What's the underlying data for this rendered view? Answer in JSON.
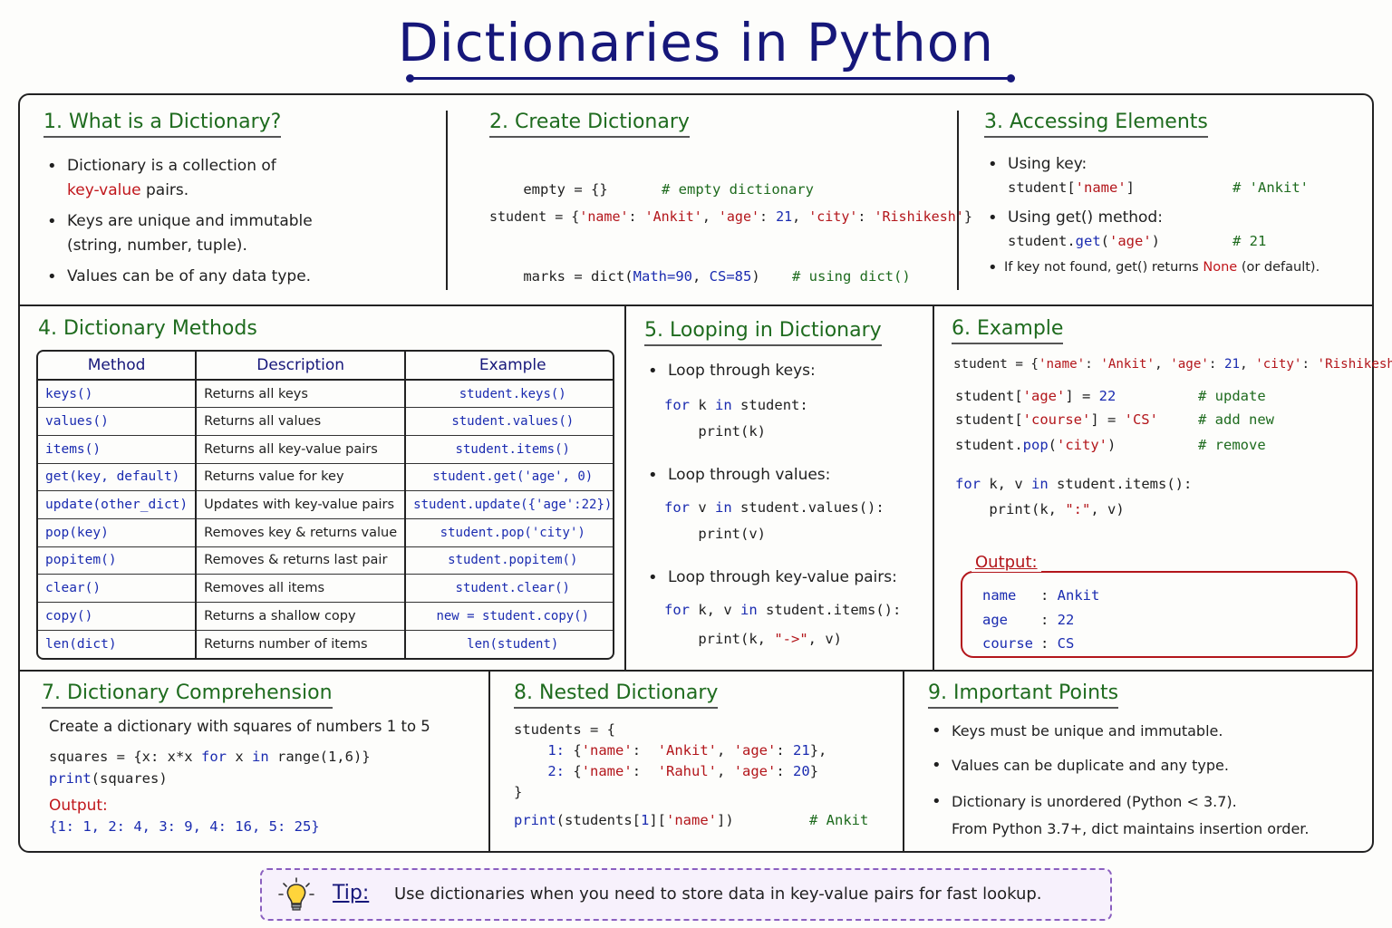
{
  "title": "Dictionaries in Python",
  "s1": {
    "heading": "1. What is a Dictionary?",
    "b1a": "Dictionary is a collection of",
    "b1b": "key-value",
    "b1c": "pairs.",
    "b2a": "Keys are unique and immutable",
    "b2b": "(string, number, tuple).",
    "b3": "Values can be of any data type."
  },
  "s2": {
    "heading": "2. Create Dictionary",
    "l1_code": "empty = {}",
    "l1_comment": "# empty dictionary",
    "l2_a": "student = {",
    "l2_k1": "'name'",
    "l2_v1": "'Ankit'",
    "l2_k2": "'age'",
    "l2_v2": "21",
    "l2_k3": "'city'",
    "l2_v3": "'Rishikesh'",
    "l3_a": "marks = dict(",
    "l3_arg1": "Math=90",
    "l3_arg2": "CS=85",
    "l3_comment": "# using dict()"
  },
  "s3": {
    "heading": "3. Accessing Elements",
    "b1": "Using key:",
    "c1_a": "student[",
    "c1_s": "'name'",
    "c1_comment": "# 'Ankit'",
    "b2": "Using get() method:",
    "c2_a": "student.",
    "c2_f": "get",
    "c2_s": "'age'",
    "c2_comment": "# 21",
    "b3a": "If key not found, get() returns",
    "b3b": "None",
    "b3c": "(or default)."
  },
  "s4": {
    "heading": "4. Dictionary Methods",
    "columns": [
      "Method",
      "Description",
      "Example"
    ],
    "rows": [
      [
        "keys()",
        "Returns all keys",
        "student.keys()"
      ],
      [
        "values()",
        "Returns all values",
        "student.values()"
      ],
      [
        "items()",
        "Returns all key-value pairs",
        "student.items()"
      ],
      [
        "get(key, default)",
        "Returns value for key",
        "student.get('age', 0)"
      ],
      [
        "update(other_dict)",
        "Updates with key-value pairs",
        "student.update({'age':22})"
      ],
      [
        "pop(key)",
        "Removes key & returns value",
        "student.pop('city')"
      ],
      [
        "popitem()",
        "Removes & returns last pair",
        "student.popitem()"
      ],
      [
        "clear()",
        "Removes all items",
        "student.clear()"
      ],
      [
        "copy()",
        "Returns a shallow copy",
        "new = student.copy()"
      ],
      [
        "len(dict)",
        "Returns number of items",
        "len(student)"
      ]
    ]
  },
  "s5": {
    "heading": "5. Looping in Dictionary",
    "b1": "Loop through keys:",
    "c1a_kw": "for",
    "c1a_v": "k",
    "c1a_in": "in",
    "c1a_r": "student:",
    "c1b": "print(k)",
    "b2": "Loop through values:",
    "c2a_v": "v",
    "c2a_r": "student.values():",
    "c2b": "print(v)",
    "b3": "Loop through key-value pairs:",
    "c3a_v": "k, v",
    "c3a_r": "student.items():",
    "c3b_a": "print(k, ",
    "c3b_s": "\"->\"",
    "c3b_c": ", v)"
  },
  "s6": {
    "heading": "6. Example",
    "line1_a": "student = {",
    "line1_k1": "'name'",
    "line1_v1": "'Ankit'",
    "line1_k2": "'age'",
    "line1_v2": "21",
    "line1_k3": "'city'",
    "line1_v3": "'Rishikesh'",
    "u1_a": "student[",
    "u1_s": "'age'",
    "u1_b": "] = ",
    "u1_n": "22",
    "u1_c": "# update",
    "u2_a": "student[",
    "u2_s": "'course'",
    "u2_b": "] = ",
    "u2_v": "'CS'",
    "u2_c": "# add new",
    "u3_a": "student.",
    "u3_f": "pop",
    "u3_s": "'city'",
    "u3_c": "# remove",
    "f1_kw": "for",
    "f1_v": "k, v",
    "f1_in": "in",
    "f1_r": "student.items():",
    "f2_a": "print(k, ",
    "f2_s": "\":\"",
    "f2_c": ", v)",
    "output_label": "Output:",
    "output": [
      [
        "name",
        "Ankit"
      ],
      [
        "age",
        "22"
      ],
      [
        "course",
        "CS"
      ]
    ]
  },
  "s7": {
    "heading": "7. Dictionary Comprehension",
    "desc": "Create a dictionary with squares of numbers 1 to 5",
    "c1_a": "squares = {x: x*x ",
    "c1_for": "for",
    "c1_b": " x ",
    "c1_in": "in",
    "c1_c": " range(1,6)}",
    "c2": "print(squares)",
    "output_label": "Output:",
    "output": "{1: 1, 2: 4, 3: 9, 4: 16, 5: 25}"
  },
  "s8": {
    "heading": "8. Nested Dictionary",
    "l1": "students = {",
    "l2_k": "1:",
    "l2_a": "{",
    "l2_s1": "'name'",
    "l2_v1": "'Ankit'",
    "l2_s2": "'age'",
    "l2_v2": "21",
    "l3_k": "2:",
    "l3_s1": "'name'",
    "l3_v1": "'Rahul'",
    "l3_s2": "'age'",
    "l3_v2": "20",
    "l4": "}",
    "p_a": "print",
    "p_b": "(students[",
    "p_n": "1",
    "p_c": "][",
    "p_s": "'name'",
    "p_d": "])",
    "p_comment": "# Ankit"
  },
  "s9": {
    "heading": "9. Important Points",
    "b1": "Keys must be unique and immutable.",
    "b2": "Values can be duplicate and any type.",
    "b3a": "Dictionary is unordered (Python < 3.7).",
    "b3b": "From Python 3.7+, dict maintains insertion order."
  },
  "tip": {
    "label": "Tip:",
    "text": "Use dictionaries when you need to store data in key-value pairs for fast lookup."
  },
  "colors": {
    "title": "#16177a",
    "heading": "#1e6b1e",
    "keyword": "#1a2bb0",
    "string": "#b3161b",
    "tip_border": "#8a5fbf"
  }
}
